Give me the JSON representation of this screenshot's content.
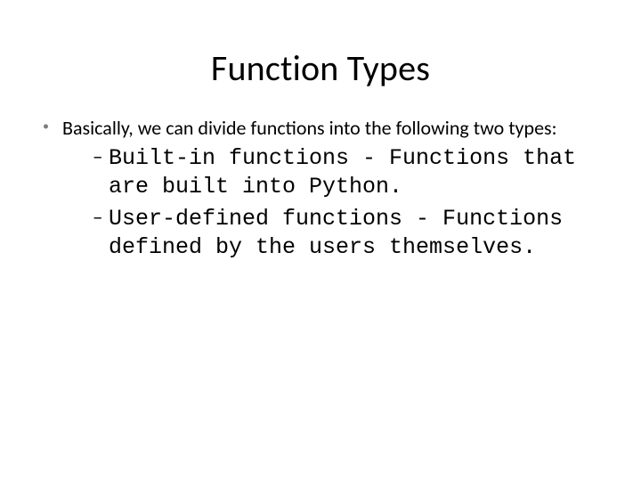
{
  "title": "Function Types",
  "bullets": {
    "l1": {
      "glyph": "•",
      "text": "Basically, we can divide functions into the following two types:"
    },
    "l2": [
      {
        "dash": "–",
        "text": "Built-in functions - Functions that are built  into Python."
      },
      {
        "dash": "–",
        "text": "User-defined functions - Functions defined by  the users themselves."
      }
    ]
  }
}
